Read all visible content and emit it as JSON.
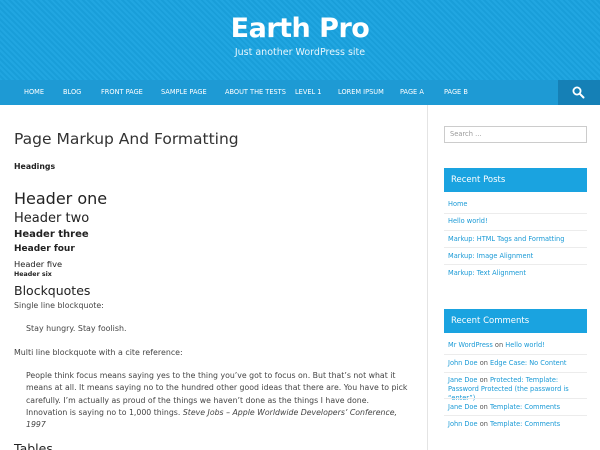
{
  "site": {
    "title": "Earth Pro",
    "description": "Just another WordPress site"
  },
  "nav": {
    "items": [
      "HOME",
      "BLOG",
      "FRONT PAGE",
      "SAMPLE PAGE",
      "ABOUT THE TESTS",
      "LEVEL 1",
      "LOREM IPSUM",
      "PAGE A",
      "PAGE B"
    ],
    "search_icon": "search-icon"
  },
  "content": {
    "title": "Page Markup And Formatting",
    "headings_label": "Headings",
    "h1": "Header one",
    "h2": "Header two",
    "h3": "Header three",
    "h4": "Header four",
    "h5": "Header five",
    "h6": "Header six",
    "blockquotes_heading": "Blockquotes",
    "single_line_label": "Single line blockquote:",
    "single_quote": "Stay hungry. Stay foolish.",
    "multi_line_label": "Multi line blockquote with a cite reference:",
    "multi_quote": "People think focus means saying yes to the thing you’ve got to focus on. But that’s not what it means at all. It means saying no to the hundred other good ideas that there are. You have to pick carefully. I’m actually as proud of the things we haven’t done as the things I have done. Innovation is saying no to 1,000 things.",
    "multi_quote_cite": "Steve Jobs – Apple Worldwide Developers’ Conference, 1997",
    "tables_heading": "Tables"
  },
  "sidebar": {
    "search_placeholder": "Search ...",
    "recent_posts_title": "Recent Posts",
    "recent_posts": [
      "Home",
      "Hello world!",
      "Markup: HTML Tags and Formatting",
      "Markup: Image Alignment",
      "Markup: Text Alignment"
    ],
    "recent_comments_title": "Recent Comments",
    "on_word": "on",
    "recent_comments": [
      {
        "author": "Mr WordPress",
        "post": "Hello world!"
      },
      {
        "author": "John Doe",
        "post": "Edge Case: No Content"
      },
      {
        "author": "Jane Doe",
        "post": "Protected: Template: Password Protected (the password is “enter”)"
      },
      {
        "author": "Jane Doe",
        "post": "Template: Comments"
      },
      {
        "author": "John Doe",
        "post": "Template: Comments"
      }
    ]
  },
  "colors": {
    "header_blue": "#1aa3e0",
    "nav_blue": "#1e9ad4",
    "search_button": "#1580b6",
    "link": "#1a9ad6"
  }
}
